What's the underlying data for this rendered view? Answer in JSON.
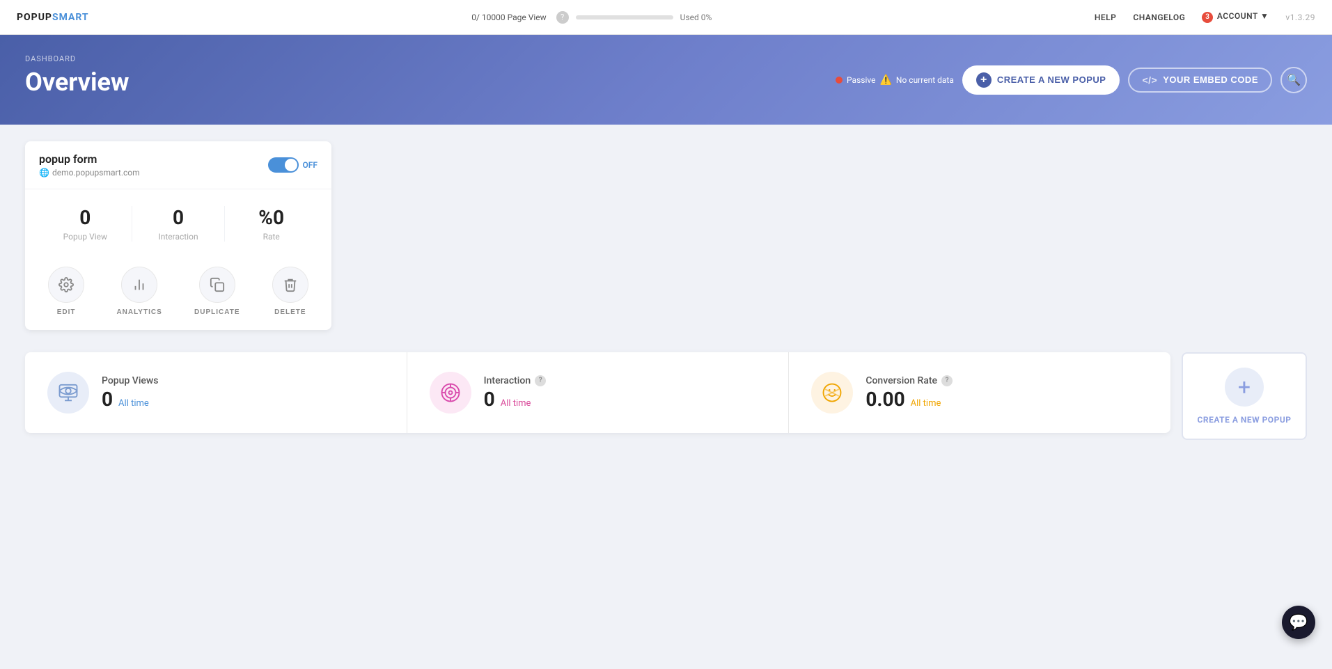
{
  "topnav": {
    "logo": "POPUPSMART",
    "page_views": "0/ 10000 Page View",
    "used": "Used 0%",
    "progress": 0,
    "help_label": "?",
    "nav_items": [
      {
        "id": "help",
        "label": "HELP"
      },
      {
        "id": "changelog",
        "label": "CHANGELOG"
      },
      {
        "id": "account",
        "label": "ACCOUNT"
      },
      {
        "id": "version",
        "label": "v1.3.29"
      }
    ],
    "account_badge": "3"
  },
  "header": {
    "breadcrumb": "DASHBOARD",
    "title": "Overview",
    "status": {
      "dot_color": "#e74c3c",
      "passive_label": "Passive",
      "warning_label": "No current data"
    },
    "btn_create_label": "CREATE A NEW POPUP",
    "btn_embed_label": "YOUR EMBED CODE"
  },
  "popup_card": {
    "title": "popup form",
    "url": "demo.popupsmart.com",
    "toggle_state": "OFF",
    "stats": [
      {
        "value": "0",
        "label": "Popup View"
      },
      {
        "value": "0",
        "label": "Interaction"
      },
      {
        "value": "%0",
        "label": "Rate"
      }
    ],
    "actions": [
      {
        "id": "edit",
        "label": "EDIT",
        "icon": "⚙"
      },
      {
        "id": "analytics",
        "label": "ANALYTICS",
        "icon": "📊"
      },
      {
        "id": "duplicate",
        "label": "DUPLICATE",
        "icon": "⧉"
      },
      {
        "id": "delete",
        "label": "DELETE",
        "icon": "🗑"
      }
    ]
  },
  "stats_bar": {
    "items": [
      {
        "id": "popup-views",
        "icon_type": "blue",
        "title": "Popup Views",
        "value": "0",
        "time_label": "All time"
      },
      {
        "id": "interaction",
        "icon_type": "pink",
        "title": "Interaction",
        "value": "0",
        "time_label": "All time"
      },
      {
        "id": "conversion-rate",
        "icon_type": "orange",
        "title": "Conversion Rate",
        "value": "0.00",
        "time_label": "All time"
      }
    ],
    "create_new_label": "CREATE A NEW POPUP"
  }
}
